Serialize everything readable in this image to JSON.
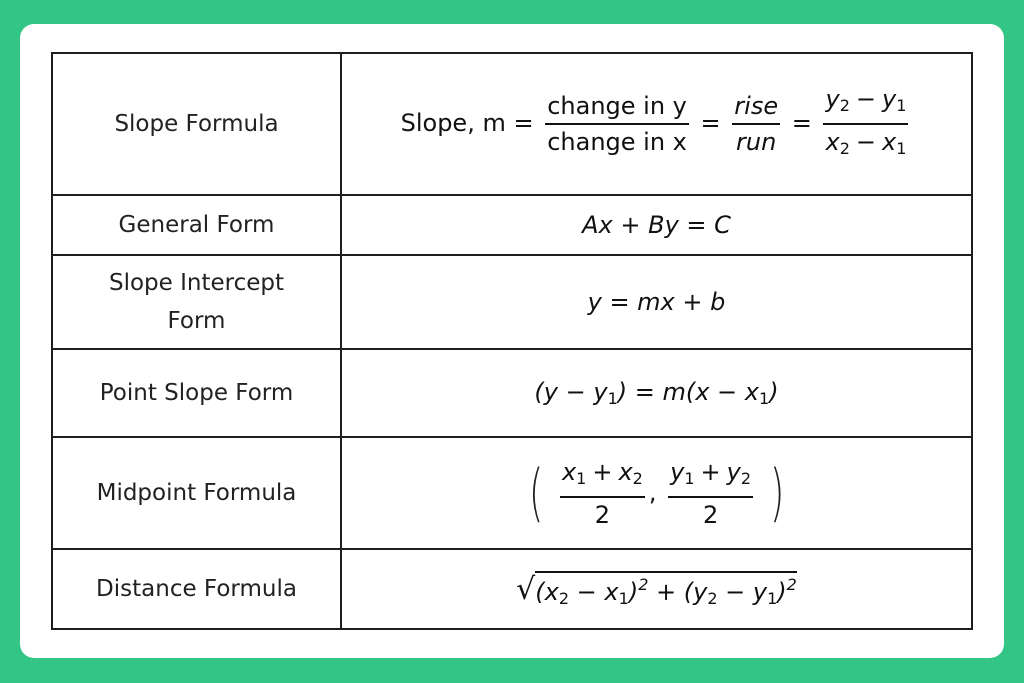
{
  "theme": {
    "background": "#33c585",
    "card": "#ffffff",
    "border": "#1e1e1e"
  },
  "rows": [
    {
      "label": "Slope Formula",
      "formula": {
        "prefix": "Slope, m =",
        "frac1_num": "change in y",
        "frac1_den": "change in x",
        "eq": "=",
        "frac2_num": "rise",
        "frac2_den": "run",
        "frac3_num_a": "y",
        "frac3_num_a_sub": "2",
        "frac3_num_op": "−",
        "frac3_num_b": "y",
        "frac3_num_b_sub": "1",
        "frac3_den_a": "x",
        "frac3_den_a_sub": "2",
        "frac3_den_op": "−",
        "frac3_den_b": "x",
        "frac3_den_b_sub": "1"
      }
    },
    {
      "label": "General Form",
      "formula": {
        "text": "Ax + By = C"
      }
    },
    {
      "label_line1": "Slope Intercept",
      "label_line2": "Form",
      "formula": {
        "text": "y = mx + b"
      }
    },
    {
      "label": "Point Slope Form",
      "formula": {
        "p1": "(y − y",
        "s1": "1",
        "p2": ") = m(x − x",
        "s2": "1",
        "p3": ")"
      }
    },
    {
      "label": "Midpoint Formula",
      "formula": {
        "lparen": "(",
        "rparen": ")",
        "comma": ",",
        "n1a": "x",
        "n1a_sub": "1",
        "n1op": "+",
        "n1b": "x",
        "n1b_sub": "2",
        "d1": "2",
        "n2a": "y",
        "n2a_sub": "1",
        "n2op": "+",
        "n2b": "y",
        "n2b_sub": "2",
        "d2": "2"
      }
    },
    {
      "label": "Distance Formula",
      "formula": {
        "root": "√",
        "a": "(x",
        "a_sub": "2",
        "b": " − x",
        "b_sub": "1",
        "c": ")",
        "c_sup": "2",
        "plus": " + ",
        "d": "(y",
        "d_sub": "2",
        "e": " − y",
        "e_sub": "1",
        "f": ")",
        "f_sup": "2"
      }
    }
  ]
}
